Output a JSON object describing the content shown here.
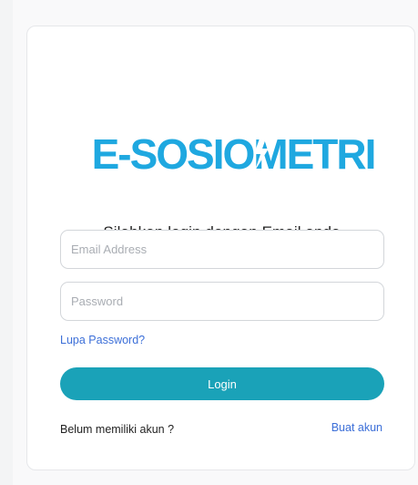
{
  "brand": {
    "logo_text": "E-SOSIOMETRI",
    "logo_color": "#1fa8e0"
  },
  "login": {
    "subtitle": "Silahkan login dengan Email anda",
    "email_placeholder": "Email Address",
    "email_value": "",
    "password_placeholder": "Password",
    "password_value": "",
    "forgot_password_label": "Lupa Password?",
    "login_button_label": "Login",
    "no_account_text": "Belum memiliki akun ?",
    "create_account_label": "Buat akun"
  },
  "colors": {
    "accent": "#1aa2b8",
    "link": "#3c6fd8"
  }
}
